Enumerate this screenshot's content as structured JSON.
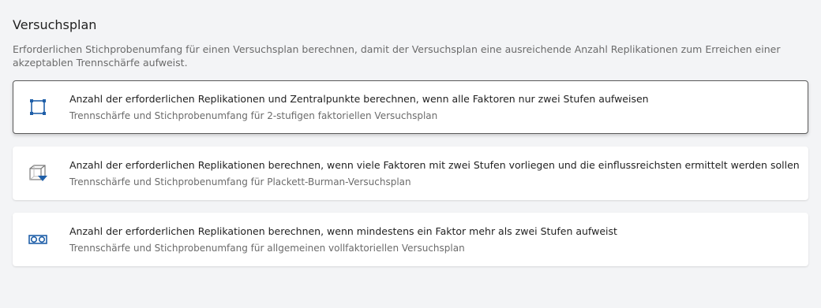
{
  "section": {
    "title": "Versuchsplan",
    "description": "Erforderlichen Stichprobenumfang für einen Versuchsplan berechnen, damit der Versuchsplan eine ausreichende Anzahl Replikationen zum Erreichen einer akzeptablen Trennschärfe aufweist."
  },
  "options": [
    {
      "title": "Anzahl der erforderlichen Replikationen und Zentralpunkte berechnen, wenn alle Faktoren nur zwei Stufen aufweisen",
      "subtitle": "Trennschärfe und Stichprobenumfang für 2-stufigen faktoriellen Versuchsplan",
      "icon": "square-corners-icon",
      "selected": true
    },
    {
      "title": "Anzahl der erforderlichen Replikationen berechnen, wenn viele Faktoren mit zwei Stufen vorliegen und die einflussreichsten ermittelt werden sollen",
      "subtitle": "Trennschärfe und Stichprobenumfang für Plackett-Burman-Versuchsplan",
      "icon": "cube-funnel-icon",
      "selected": false
    },
    {
      "title": "Anzahl der erforderlichen Replikationen berechnen, wenn mindestens ein Faktor mehr als zwei Stufen aufweist",
      "subtitle": "Trennschärfe und Stichprobenumfang für allgemeinen vollfaktoriellen Versuchsplan",
      "icon": "double-circle-icon",
      "selected": false
    }
  ],
  "colors": {
    "accent": "#1f5fa8",
    "selected_border": "#5a5a5a",
    "background": "#f3f4f6"
  }
}
